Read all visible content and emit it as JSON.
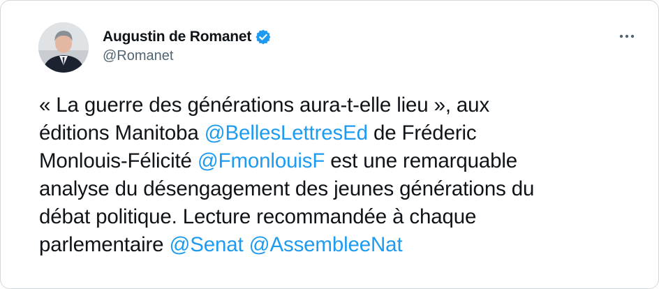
{
  "author": {
    "display_name": "Augustin de Romanet",
    "handle": "@Romanet",
    "verified": true,
    "avatar_icon": "profile-photo"
  },
  "menu": {
    "icon": "more-horizontal-icon"
  },
  "tweet": {
    "lines": [
      [
        {
          "text": "« La guerre des générations aura-t-elle lieu », aux",
          "type": "text"
        }
      ],
      [
        {
          "text": "éditions Manitoba ",
          "type": "text"
        },
        {
          "text": "@BellesLettresEd",
          "type": "mention"
        },
        {
          "text": " de Fréderic",
          "type": "text"
        }
      ],
      [
        {
          "text": "Monlouis-Félicité ",
          "type": "text"
        },
        {
          "text": "@FmonlouisF",
          "type": "mention"
        },
        {
          "text": " est une remarquable",
          "type": "text"
        }
      ],
      [
        {
          "text": "analyse du désengagement des jeunes générations du",
          "type": "text"
        }
      ],
      [
        {
          "text": "débat politique. Lecture recommandée à chaque",
          "type": "text"
        }
      ],
      [
        {
          "text": "parlementaire ",
          "type": "text"
        },
        {
          "text": "@Senat",
          "type": "mention"
        },
        {
          "text": " ",
          "type": "text"
        },
        {
          "text": "@AssembleeNat",
          "type": "mention"
        }
      ]
    ]
  },
  "colors": {
    "mention": "#1d9bf0",
    "text": "#0f1419",
    "secondary": "#536471",
    "verified_badge": "#1d9bf0"
  }
}
